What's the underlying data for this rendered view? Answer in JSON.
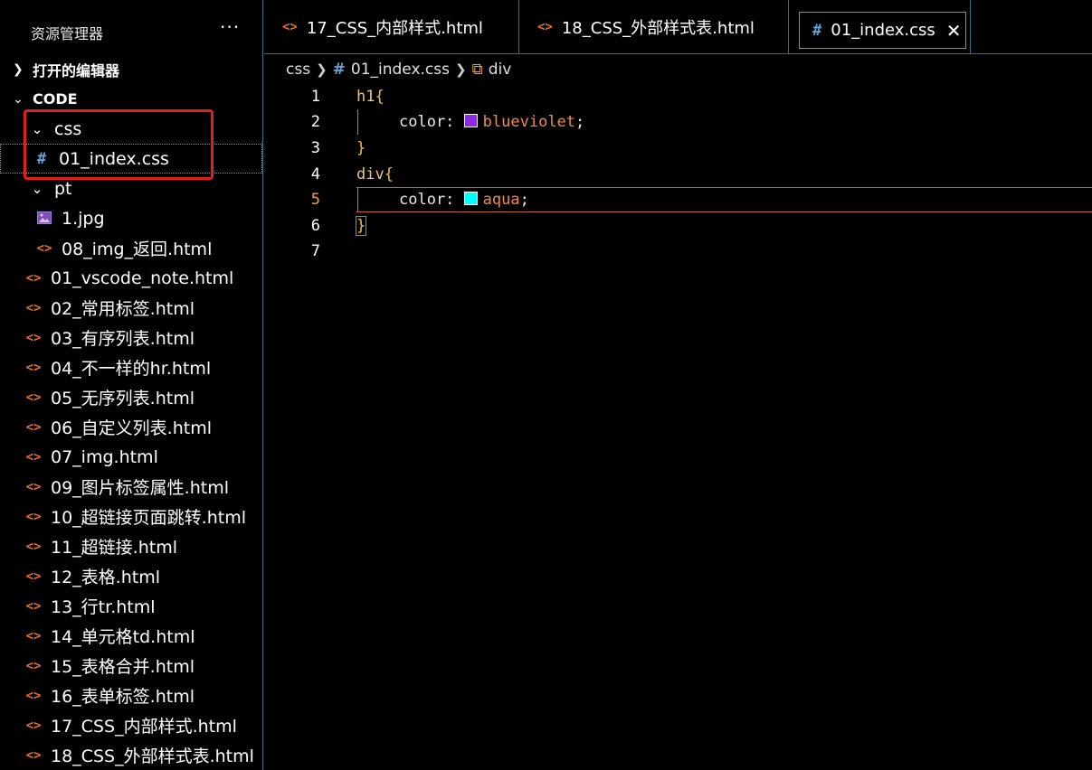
{
  "sidebar": {
    "title": "资源管理器",
    "more": "···",
    "open_editors": "打开的编辑器",
    "root": "CODE",
    "items": [
      {
        "label": "css",
        "type": "folder"
      },
      {
        "label": "01_index.css",
        "type": "css"
      },
      {
        "label": "pt",
        "type": "folder"
      },
      {
        "label": "1.jpg",
        "type": "image"
      },
      {
        "label": "08_img_返回.html",
        "type": "html"
      },
      {
        "label": "01_vscode_note.html",
        "type": "html"
      },
      {
        "label": "02_常用标签.html",
        "type": "html"
      },
      {
        "label": "03_有序列表.html",
        "type": "html"
      },
      {
        "label": "04_不一样的hr.html",
        "type": "html"
      },
      {
        "label": "05_无序列表.html",
        "type": "html"
      },
      {
        "label": "06_自定义列表.html",
        "type": "html"
      },
      {
        "label": "07_img.html",
        "type": "html"
      },
      {
        "label": "09_图片标签属性.html",
        "type": "html"
      },
      {
        "label": "10_超链接页面跳转.html",
        "type": "html"
      },
      {
        "label": "11_超链接.html",
        "type": "html"
      },
      {
        "label": "12_表格.html",
        "type": "html"
      },
      {
        "label": "13_行tr.html",
        "type": "html"
      },
      {
        "label": "14_单元格td.html",
        "type": "html"
      },
      {
        "label": "15_表格合并.html",
        "type": "html"
      },
      {
        "label": "16_表单标签.html",
        "type": "html"
      },
      {
        "label": "17_CSS_内部样式.html",
        "type": "html"
      },
      {
        "label": "18_CSS_外部样式表.html",
        "type": "html"
      }
    ]
  },
  "tabs": [
    {
      "label": "17_CSS_内部样式.html"
    },
    {
      "label": "18_CSS_外部样式表.html"
    },
    {
      "label": "01_index.css",
      "close": "✕"
    }
  ],
  "breadcrumb": {
    "folder": "css",
    "file": "01_index.css",
    "symbol": "div"
  },
  "editor": {
    "line_numbers": [
      "1",
      "2",
      "3",
      "4",
      "5",
      "6",
      "7"
    ],
    "lines": [
      {
        "selector": "h1",
        "open": "{"
      },
      {
        "prop": "color:",
        "value": "blueviolet",
        "swatch": "#8a2be2",
        "end": ";"
      },
      {
        "close": "}"
      },
      {
        "selector": "div",
        "open": "{"
      },
      {
        "prop": "color:",
        "value": "aqua",
        "swatch": "#00ffff",
        "end": ";"
      },
      {
        "close": "}"
      },
      {}
    ],
    "current_line": "5"
  },
  "colors": {
    "html_icon": "#e8702c",
    "css_icon": "#6aa3d8",
    "highlight_box": "#e0201d"
  }
}
